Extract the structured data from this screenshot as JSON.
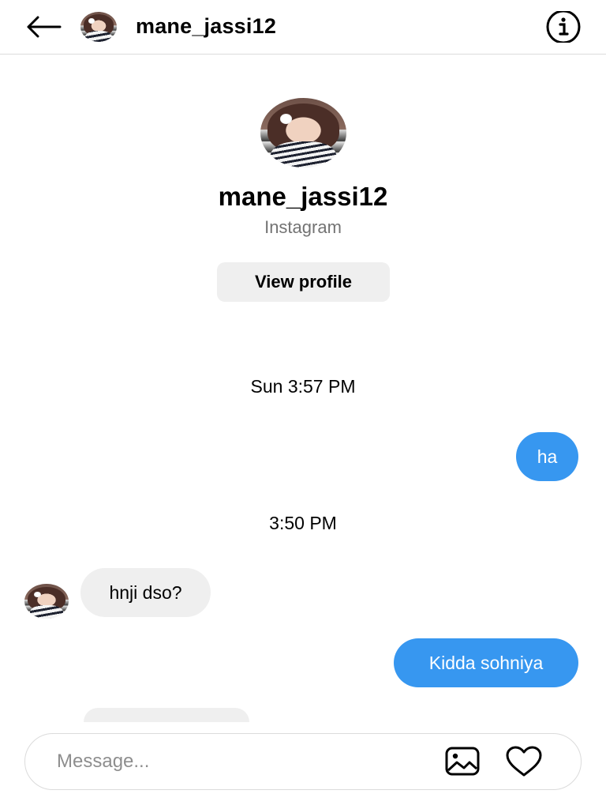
{
  "header": {
    "username": "mane_jassi12",
    "icons": {
      "back": "arrow-left-icon",
      "info": "info-icon"
    }
  },
  "profile": {
    "username": "mane_jassi12",
    "source": "Instagram",
    "view_profile_label": "View profile"
  },
  "messages": [
    {
      "type": "timestamp",
      "text": "Sun 3:57 PM"
    },
    {
      "type": "sent",
      "text": "ha"
    },
    {
      "type": "timestamp",
      "text": "3:50 PM"
    },
    {
      "type": "received",
      "text": "hnji dso?"
    },
    {
      "type": "sent",
      "text": "Kidda sohniya"
    }
  ],
  "composer": {
    "placeholder": "Message...",
    "icons": {
      "gallery": "image-icon",
      "like": "heart-icon"
    }
  },
  "colors": {
    "sent_bubble": "#3797f0",
    "received_bubble": "#efefef",
    "secondary_text": "#737373",
    "divider": "#dbdbdb"
  }
}
